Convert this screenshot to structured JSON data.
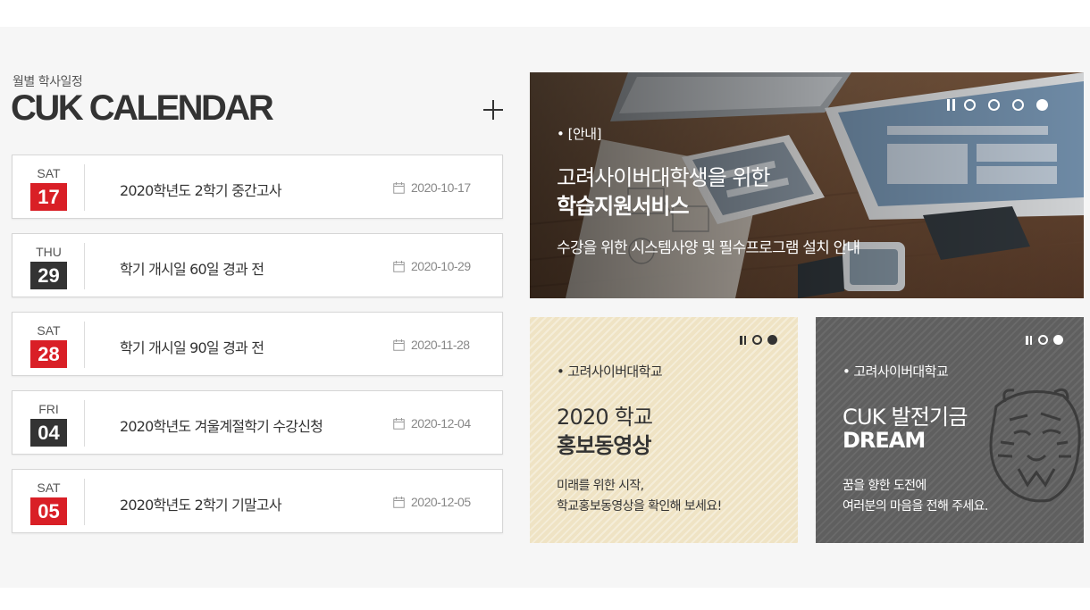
{
  "calendar": {
    "subtitle": "월별 학사일정",
    "title": "CUK CALENDAR",
    "events": [
      {
        "weekday": "SAT",
        "day": "17",
        "title": "2020학년도 2학기 중간고사",
        "date": "2020-10-17",
        "color": "#d91f26"
      },
      {
        "weekday": "THU",
        "day": "29",
        "title": "학기 개시일 60일 경과 전",
        "date": "2020-10-29",
        "color": "#333333"
      },
      {
        "weekday": "SAT",
        "day": "28",
        "title": "학기 개시일 90일 경과 전",
        "date": "2020-11-28",
        "color": "#d91f26"
      },
      {
        "weekday": "FRI",
        "day": "04",
        "title": "2020학년도 겨울계절학기 수강신청",
        "date": "2020-12-04",
        "color": "#333333"
      },
      {
        "weekday": "SAT",
        "day": "05",
        "title": "2020학년도 2학기 기말고사",
        "date": "2020-12-05",
        "color": "#d91f26"
      }
    ]
  },
  "main_banner": {
    "tag": "• [안내]",
    "line1": "고려사이버대학생을 위한",
    "line2": "학습지원서비스",
    "description": "수강을 위한 시스템사양 및 필수프로그램 설치 안내",
    "slides": 4,
    "active_slide": 4
  },
  "promo_card": {
    "tag": "• 고려사이버대학교",
    "line1": "2020 학교",
    "line2": "홍보동영상",
    "desc1": "미래를 위한 시작,",
    "desc2": "학교홍보동영상을 확인해 보세요!",
    "slides": 2,
    "active_slide": 2,
    "bg_color": "#efe3c4"
  },
  "fund_card": {
    "tag": "• 고려사이버대학교",
    "line1": "CUK 발전기금",
    "line2": "DREAM",
    "desc1": "꿈을 향한 도전에",
    "desc2": "여러분의 마음을 전해 주세요.",
    "slides": 2,
    "active_slide": 2,
    "bg_color": "#5f5f5f"
  },
  "icons": [
    "plus-icon",
    "calendar-icon",
    "pause-icon",
    "slide-dot-icon",
    "tiger-icon"
  ],
  "colors": {
    "accent_red": "#d91f26",
    "dark": "#333333",
    "band": "#f6f6f6"
  }
}
